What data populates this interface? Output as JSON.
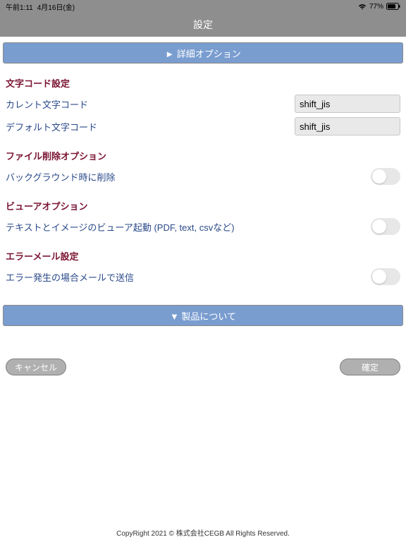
{
  "status": {
    "time": "午前1:11",
    "date": "4月16日(金)",
    "battery_pct": "77%"
  },
  "title": "設定",
  "advanced_btn": "► 詳細オプション",
  "sections": {
    "charcode": {
      "heading": "文字コード設定",
      "current_label": "カレント文字コード",
      "current_value": "shift_jis",
      "default_label": "デフォルト文字コード",
      "default_value": "shift_jis"
    },
    "filedelete": {
      "heading": "ファイル削除オプション",
      "bg_delete_label": "バックグラウンド時に削除"
    },
    "viewer": {
      "heading": "ビューアオプション",
      "launch_label": "テキストとイメージのビューア起動 (PDF, text, csvなど)"
    },
    "errormail": {
      "heading": "エラーメール設定",
      "send_label": "エラー発生の場合メールで送信"
    }
  },
  "about_btn": "▼ 製品について",
  "buttons": {
    "cancel": "キャンセル",
    "confirm": "確定"
  },
  "copyright": "CopyRight 2021 © 株式会社CEGB All Rights Reserved."
}
